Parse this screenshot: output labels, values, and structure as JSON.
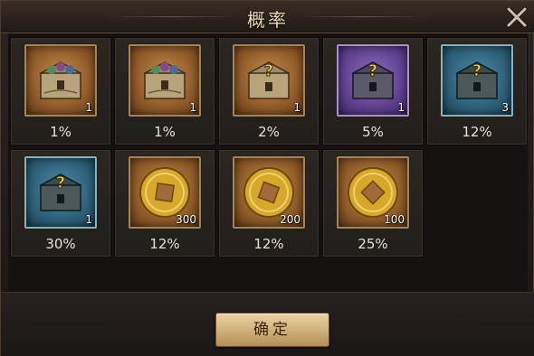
{
  "dialog": {
    "title": "概率",
    "confirm_label": "确定"
  },
  "items": [
    {
      "type": "chest",
      "tier": "brown",
      "question_mark": false,
      "quantity": "1",
      "probability": "1%"
    },
    {
      "type": "chest",
      "tier": "brown",
      "question_mark": false,
      "quantity": "1",
      "probability": "1%"
    },
    {
      "type": "chest",
      "tier": "brown",
      "question_mark": true,
      "quantity": "1",
      "probability": "2%"
    },
    {
      "type": "chest",
      "tier": "purple",
      "question_mark": true,
      "quantity": "1",
      "probability": "5%"
    },
    {
      "type": "chest",
      "tier": "blue",
      "question_mark": true,
      "quantity": "3",
      "probability": "12%"
    },
    {
      "type": "chest",
      "tier": "blue",
      "question_mark": true,
      "quantity": "1",
      "probability": "30%"
    },
    {
      "type": "gold-coin",
      "tier": "gold",
      "question_mark": false,
      "quantity": "300",
      "probability": "12%"
    },
    {
      "type": "gold-coin",
      "tier": "gold",
      "question_mark": false,
      "quantity": "200",
      "probability": "12%"
    },
    {
      "type": "gold-coin",
      "tier": "gold",
      "question_mark": false,
      "quantity": "100",
      "probability": "25%"
    }
  ],
  "colors": {
    "title_text": "#e9d6b4",
    "button_face": "#cfae78",
    "button_text": "#3b2410",
    "panel_bg": "#1a1614",
    "percent_text": "#e6e0d6"
  },
  "icons": {
    "close": "close-x-icon",
    "chest": "treasure-chest-icon",
    "coin": "gold-coin-icon"
  }
}
